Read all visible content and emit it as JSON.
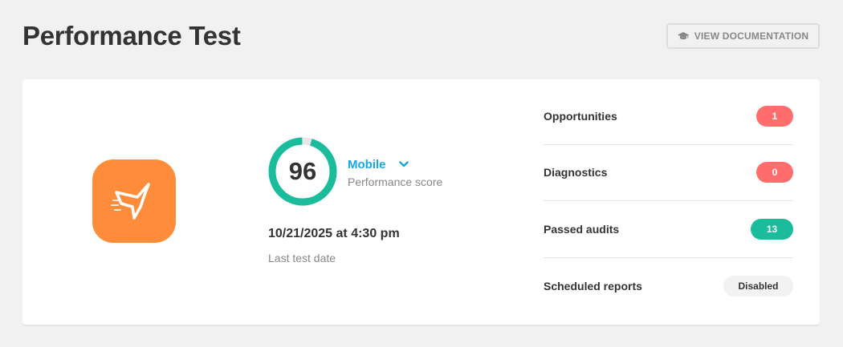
{
  "header": {
    "title": "Performance Test",
    "doc_button_label": "VIEW DOCUMENTATION",
    "doc_button_icon": "graduation-cap-icon"
  },
  "app": {
    "logo_icon": "hummingbird-logo-icon",
    "logo_color": "#ff8c3a"
  },
  "score": {
    "value": 96,
    "value_text": "96",
    "max": 100,
    "device": "Mobile",
    "label": "Performance score",
    "ring_color": "#1abc9c",
    "track_color": "#e6e6e6"
  },
  "last_test": {
    "date": "10/21/2025 at 4:30 pm",
    "label": "Last test date"
  },
  "stats": [
    {
      "label": "Opportunities",
      "value": "1",
      "status": "error",
      "color": "#ff6d6d"
    },
    {
      "label": "Diagnostics",
      "value": "0",
      "status": "error",
      "color": "#ff6d6d"
    },
    {
      "label": "Passed audits",
      "value": "13",
      "status": "success",
      "color": "#1abc9c"
    },
    {
      "label": "Scheduled reports",
      "value": "Disabled",
      "status": "neutral",
      "color": "#f2f2f2"
    }
  ]
}
